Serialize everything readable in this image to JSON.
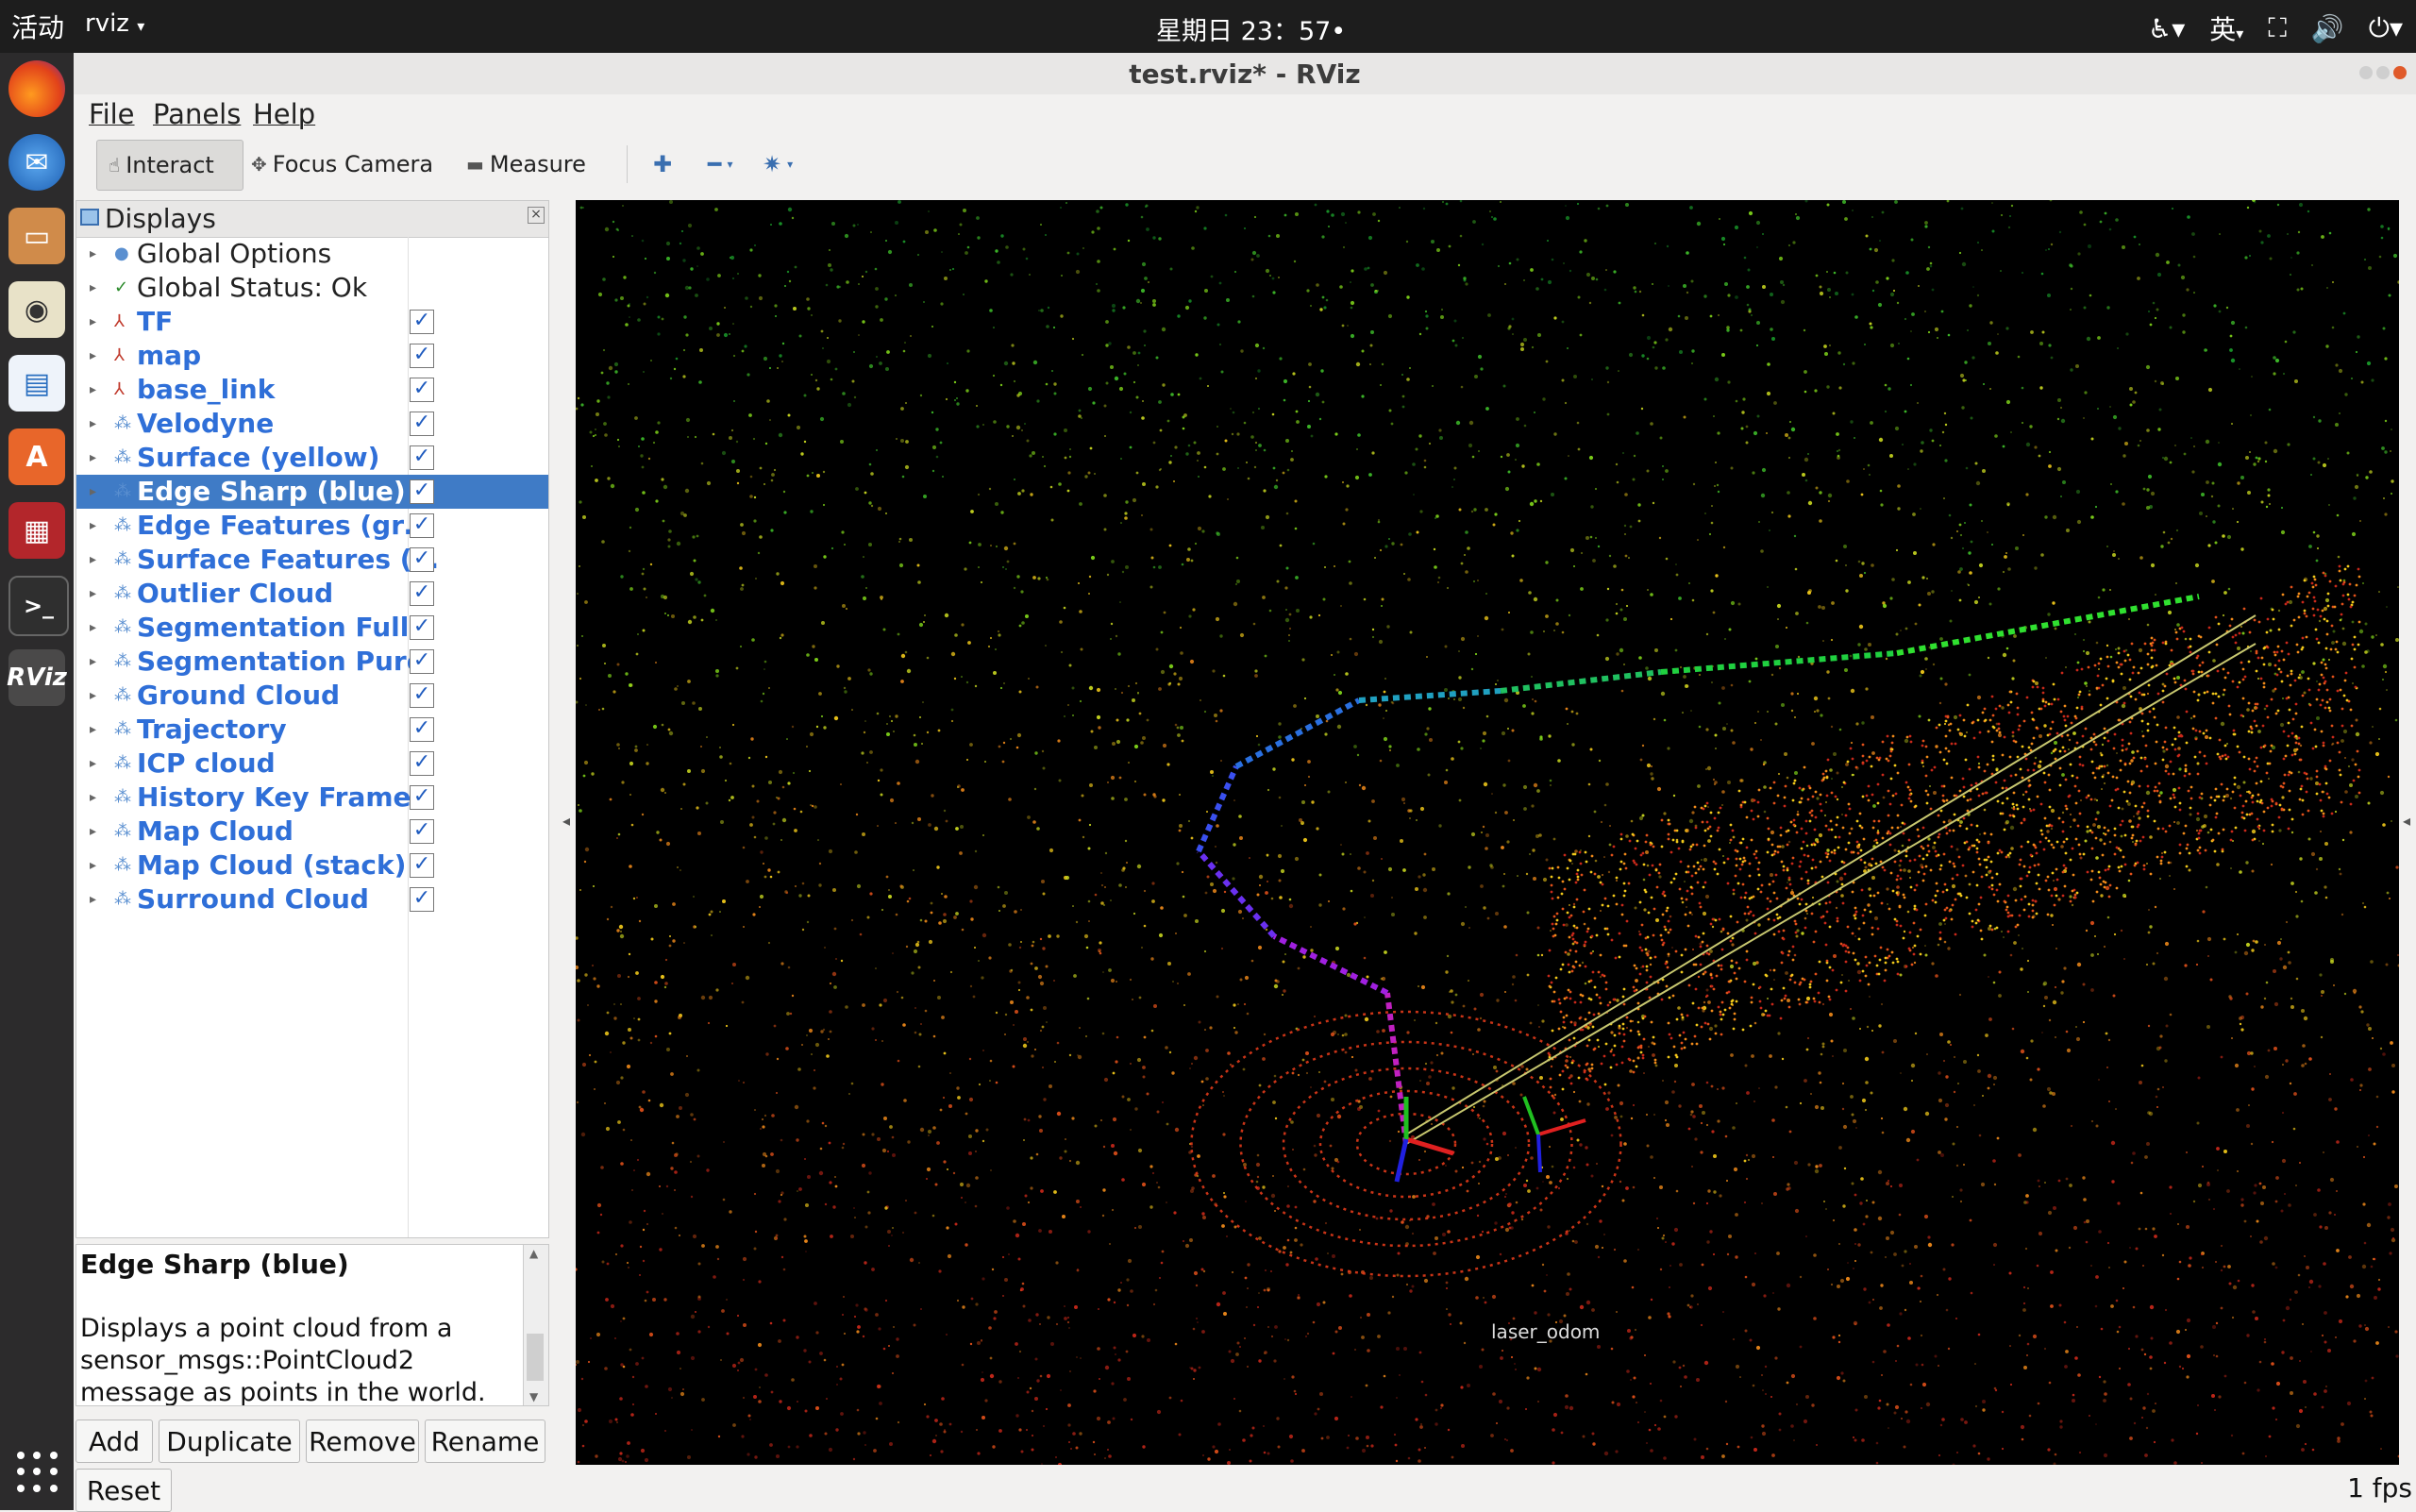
{
  "topbar": {
    "activities": "活动",
    "app_menu": "rviz",
    "clock": "星期日 23：57•",
    "input_method": "英"
  },
  "window": {
    "title": "test.rviz* - RViz"
  },
  "menu": [
    "File",
    "Panels",
    "Help"
  ],
  "toolbar": {
    "interact": "Interact",
    "focus_camera": "Focus Camera",
    "measure": "Measure"
  },
  "displays": {
    "title": "Displays",
    "items": [
      {
        "label": "Global Options",
        "checkbox": false,
        "bold": false
      },
      {
        "label": "Global Status: Ok",
        "checkbox": false,
        "bold": false
      },
      {
        "label": "TF",
        "checkbox": true,
        "bold": true
      },
      {
        "label": "map",
        "checkbox": true,
        "bold": true
      },
      {
        "label": "base_link",
        "checkbox": true,
        "bold": true
      },
      {
        "label": "Velodyne",
        "checkbox": true,
        "bold": true
      },
      {
        "label": "Surface (yellow)",
        "checkbox": true,
        "bold": true
      },
      {
        "label": "Edge Sharp (blue)",
        "checkbox": true,
        "bold": true,
        "selected": true
      },
      {
        "label": "Edge Features (gr…",
        "checkbox": true,
        "bold": true
      },
      {
        "label": "Surface Features (…",
        "checkbox": true,
        "bold": true
      },
      {
        "label": "Outlier Cloud",
        "checkbox": true,
        "bold": true
      },
      {
        "label": "Segmentation Full",
        "checkbox": true,
        "bold": true
      },
      {
        "label": "Segmentation Pure",
        "checkbox": true,
        "bold": true
      },
      {
        "label": "Ground Cloud",
        "checkbox": true,
        "bold": true
      },
      {
        "label": "Trajectory",
        "checkbox": true,
        "bold": true
      },
      {
        "label": "ICP cloud",
        "checkbox": true,
        "bold": true
      },
      {
        "label": "History Key Frames",
        "checkbox": true,
        "bold": true
      },
      {
        "label": "Map Cloud",
        "checkbox": true,
        "bold": true
      },
      {
        "label": "Map Cloud (stack)",
        "checkbox": true,
        "bold": true
      },
      {
        "label": "Surround Cloud",
        "checkbox": true,
        "bold": true
      }
    ]
  },
  "description": {
    "title": "Edge Sharp (blue)",
    "body": "Displays a point cloud from a sensor_msgs::PointCloud2 message as points in the world."
  },
  "buttons": {
    "add": "Add",
    "duplicate": "Duplicate",
    "remove": "Remove",
    "rename": "Rename",
    "reset": "Reset"
  },
  "viewport": {
    "frame_label_1": "laser_odom"
  },
  "status": {
    "fps": "1 fps"
  },
  "colors": {
    "selection": "#3f7bc6",
    "display_label": "#2f6fd8"
  }
}
